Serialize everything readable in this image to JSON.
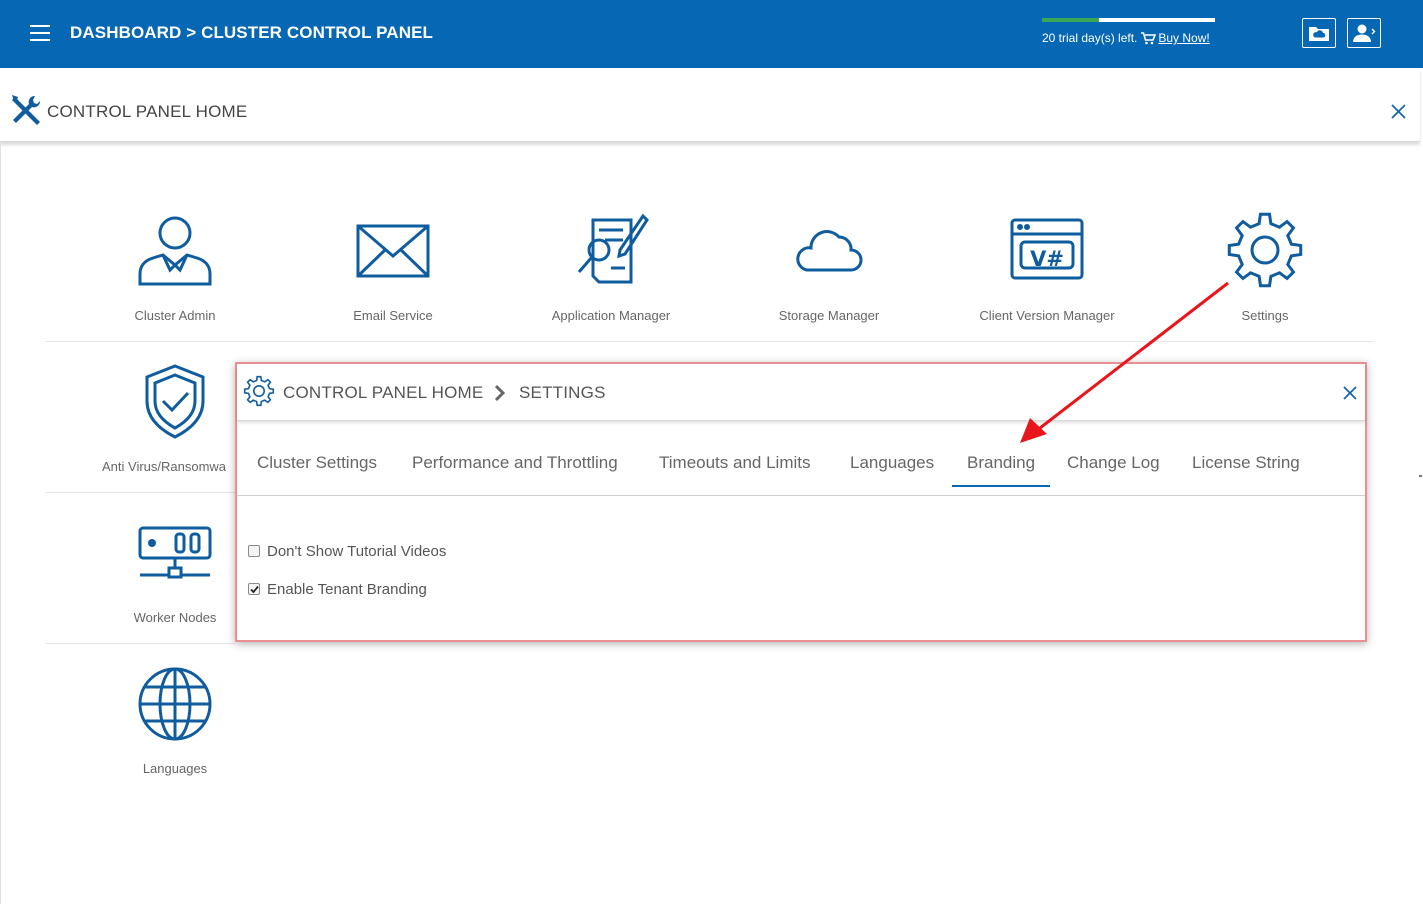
{
  "topbar": {
    "breadcrumb": "DASHBOARD > CLUSTER CONTROL PANEL",
    "trial_text": "20 trial day(s) left.",
    "buy_link": "Buy Now!",
    "trial_progress": 0.33,
    "colors": {
      "bar": "#0667b4",
      "progress": "#3aa757"
    },
    "icons": [
      "menu-icon",
      "cart-icon",
      "cloud-folder-icon",
      "user-icon"
    ]
  },
  "page_header": {
    "title": "CONTROL PANEL HOME",
    "icon": "tools-icon"
  },
  "tiles": [
    {
      "label": "Cluster Admin",
      "icon": "user-admin-icon"
    },
    {
      "label": "Email Service",
      "icon": "envelope-icon"
    },
    {
      "label": "Application Manager",
      "icon": "document-search-icon"
    },
    {
      "label": "Storage Manager",
      "icon": "cloud-icon"
    },
    {
      "label": "Client Version Manager",
      "icon": "version-window-icon",
      "badge": "V#"
    },
    {
      "label": "Settings",
      "icon": "gear-icon"
    },
    {
      "label": "Anti Virus/Ransomwa",
      "icon": "shield-check-icon"
    },
    {
      "label": "Worker Nodes",
      "icon": "server-icon"
    },
    {
      "label": "Languages",
      "icon": "globe-icon"
    }
  ],
  "settings_dialog": {
    "breadcrumb_home": "CONTROL PANEL HOME",
    "breadcrumb_current": "SETTINGS",
    "tabs": [
      {
        "label": "Cluster Settings"
      },
      {
        "label": "Performance and Throttling"
      },
      {
        "label": "Timeouts and Limits"
      },
      {
        "label": "Languages"
      },
      {
        "label": "Branding",
        "active": true
      },
      {
        "label": "Change Log"
      },
      {
        "label": "License String"
      }
    ],
    "options": [
      {
        "label": "Don't Show Tutorial Videos",
        "checked": false
      },
      {
        "label": "Enable Tenant Branding",
        "checked": true
      }
    ],
    "colors": {
      "highlight_border": "#ea8f92",
      "active_tab": "#0667b4"
    }
  },
  "annotation": {
    "arrow_color": "#e8161b"
  }
}
